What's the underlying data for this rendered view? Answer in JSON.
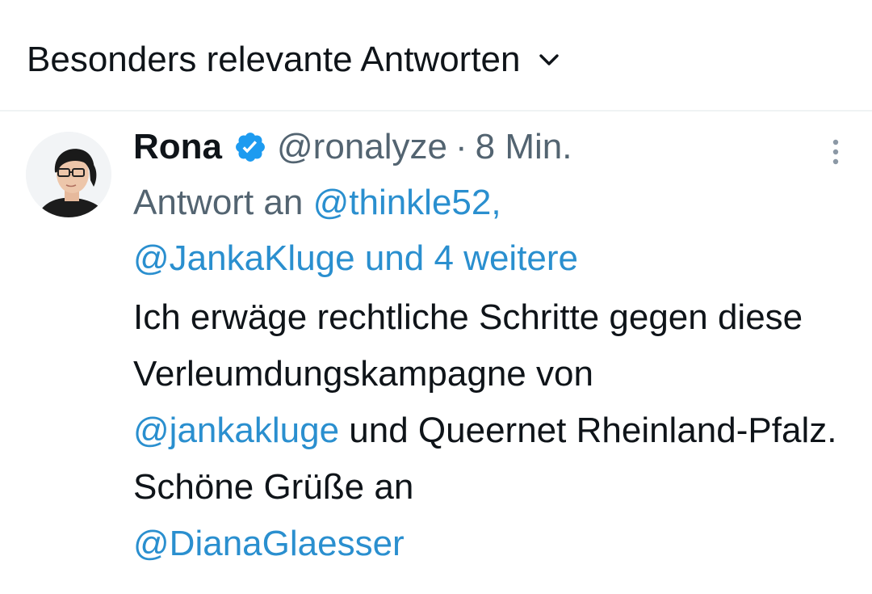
{
  "header": {
    "sort_label": "Besonders relevante Antworten",
    "chevron_icon": "chevron-down-icon"
  },
  "tweet": {
    "display_name": "Rona",
    "verified_icon": "verified-badge-icon",
    "handle": "@ronalyze",
    "separator": "·",
    "time": "8 Min.",
    "more_icon": "more-vertical-icon",
    "reply_prefix": "Antwort an",
    "reply_mention_1": "@thinkle52,",
    "reply_mention_2": "@JankaKluge und 4 weitere",
    "text_1": "Ich erwäge rechtliche Schritte gegen diese Verleumdungskampagne von",
    "mention_1": "@jankakluge",
    "text_2": "und Queernet Rheinland-Pfalz. Schöne Grüße an",
    "mention_2": "@DianaGlaesser"
  },
  "colors": {
    "link": "#2a8fcf",
    "text": "#0f1419",
    "muted": "#536471",
    "divider": "#eff3f4",
    "verified": "#1d9bf0"
  }
}
